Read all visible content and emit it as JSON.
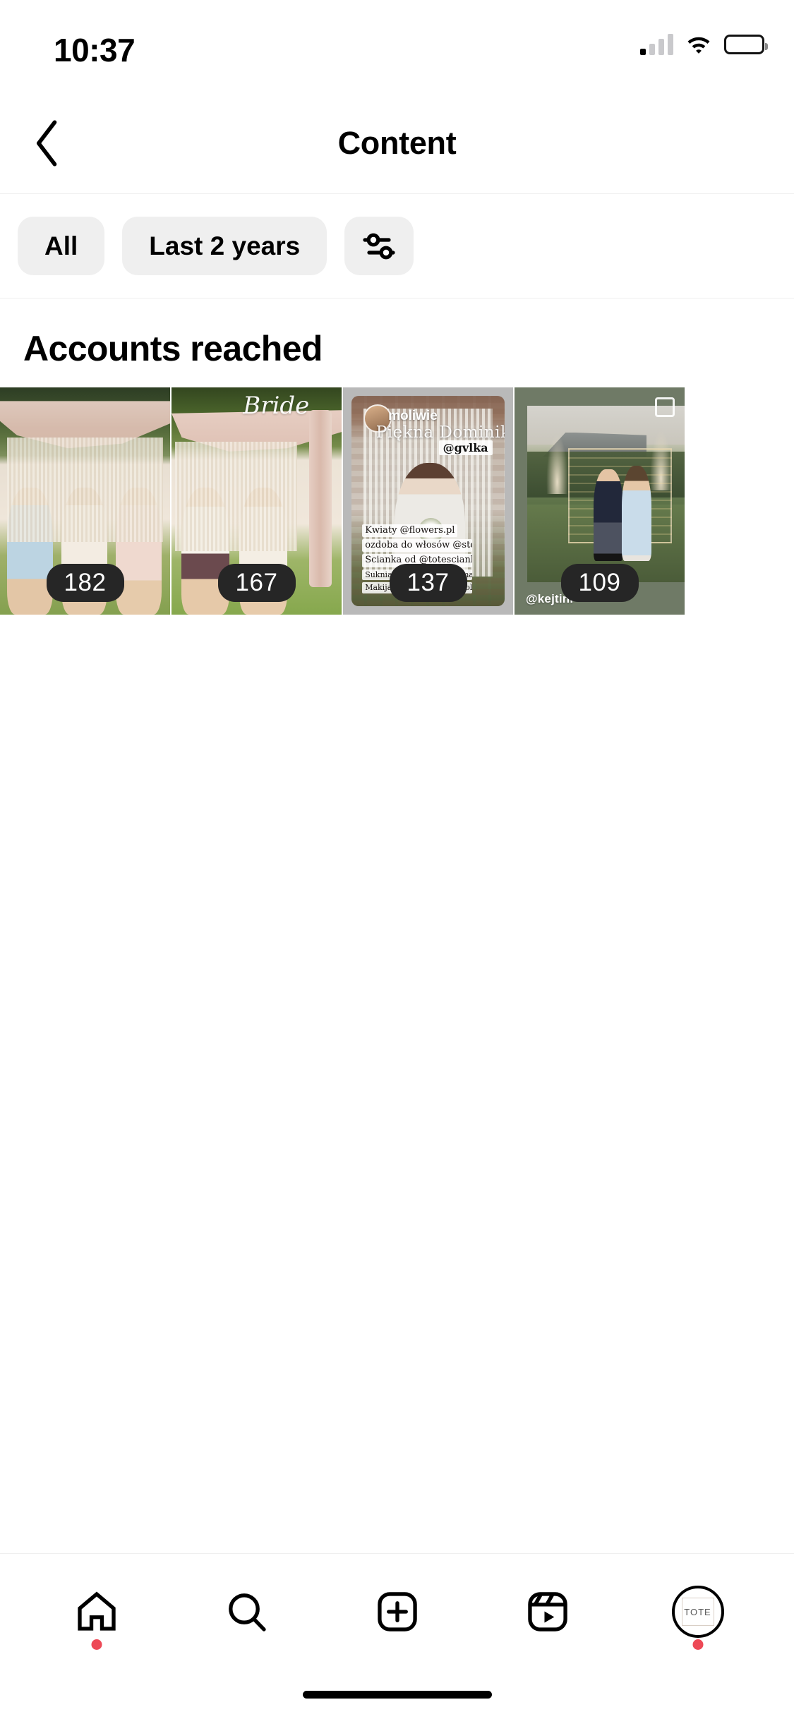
{
  "status_bar": {
    "time": "10:37",
    "cellular_icon": "cellular-signal-icon",
    "wifi_icon": "wifi-icon",
    "battery_icon": "battery-icon"
  },
  "nav": {
    "back_icon": "chevron-left-icon",
    "title": "Content"
  },
  "filters": {
    "pills": [
      {
        "label": "All",
        "name": "filter-pill-all"
      },
      {
        "label": "Last 2 years",
        "name": "filter-pill-date-range"
      }
    ],
    "settings_icon": "sliders-icon"
  },
  "section": {
    "title": "Accounts reached"
  },
  "grid": {
    "items": [
      {
        "name": "content-post-1",
        "metric_value": "182",
        "art": "a1",
        "type": "post"
      },
      {
        "name": "content-post-2",
        "metric_value": "167",
        "art": "a2",
        "type": "post",
        "overlay_script": "Bride"
      },
      {
        "name": "content-post-3",
        "metric_value": "137",
        "art": "a3",
        "type": "story",
        "story": {
          "username": "moliwie",
          "title": "Piękna Dominika!",
          "tag": "@gvlka",
          "stickers": [
            "Kwiaty @flowers.pl",
            "ozdoba do włosów @stonestory.pl",
            "Scianka od @totescianki",
            "Suknia @suknie_boho @martatrojanowska",
            "Makijaż& włosy @ryczywolska"
          ]
        }
      },
      {
        "name": "content-post-4",
        "metric_value": "109",
        "art": "a4",
        "type": "story",
        "handle": "@kejtini"
      }
    ]
  },
  "tabbar": {
    "items": [
      {
        "name": "tab-home",
        "icon": "home-icon",
        "has_dot": true
      },
      {
        "name": "tab-search",
        "icon": "search-icon",
        "has_dot": false
      },
      {
        "name": "tab-create",
        "icon": "plus-box-icon",
        "has_dot": false
      },
      {
        "name": "tab-reels",
        "icon": "reels-icon",
        "has_dot": false
      },
      {
        "name": "tab-profile",
        "icon": "avatar-icon",
        "has_dot": true,
        "avatar_label": "TOTE"
      }
    ]
  },
  "colors": {
    "accent_dot": "#ed4956",
    "pill_bg": "#efefef",
    "badge_bg": "#262626",
    "text": "#000000"
  }
}
